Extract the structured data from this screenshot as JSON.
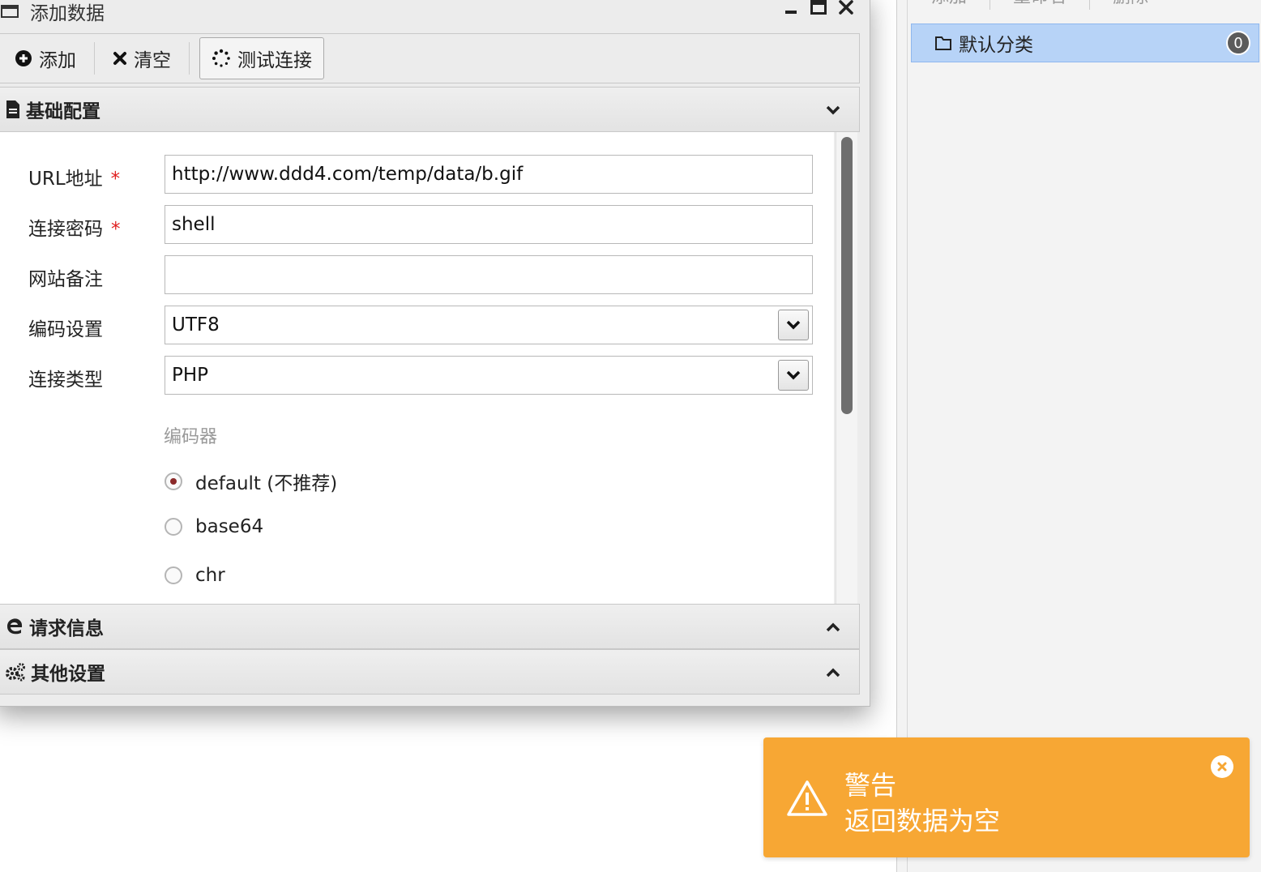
{
  "right_panel": {
    "toolbar": [
      "添加",
      "重命名",
      "删除"
    ],
    "category": {
      "label": "默认分类",
      "count": "0"
    }
  },
  "dialog": {
    "title": "添加数据",
    "toolbar": {
      "add": "添加",
      "clear": "清空",
      "test": "测试连接"
    },
    "sections": {
      "basic": "基础配置",
      "request": "请求信息",
      "other": "其他设置"
    },
    "form": {
      "url": {
        "label": "URL地址",
        "required": "*",
        "value": "http://www.ddd4.com/temp/data/b.gif"
      },
      "password": {
        "label": "连接密码",
        "required": "*",
        "value": "shell"
      },
      "note": {
        "label": "网站备注",
        "value": ""
      },
      "encoding": {
        "label": "编码设置",
        "value": "UTF8"
      },
      "type": {
        "label": "连接类型",
        "value": "PHP"
      },
      "encoder": {
        "label": "编码器",
        "options": [
          "default (不推荐)",
          "base64",
          "chr"
        ],
        "selected": 0
      }
    }
  },
  "toast": {
    "title": "警告",
    "message": "返回数据为空",
    "color": "#f7a734"
  }
}
